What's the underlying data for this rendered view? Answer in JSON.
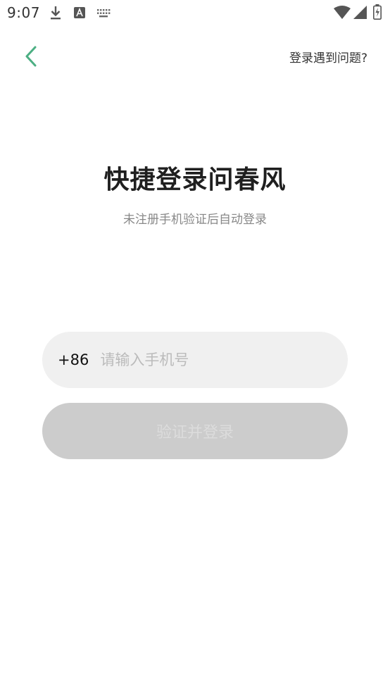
{
  "status_bar": {
    "time": "9:07",
    "icons": [
      "download-icon",
      "text-a-icon",
      "keyboard-icon",
      "wifi-icon",
      "signal-icon",
      "battery-icon"
    ]
  },
  "header": {
    "back_icon": "chevron-left-icon",
    "help_label": "登录遇到问题?"
  },
  "main": {
    "title": "快捷登录问春风",
    "subtitle": "未注册手机验证后自动登录",
    "phone": {
      "country_code": "+86",
      "value": "",
      "placeholder": "请输入手机号"
    },
    "submit_label": "验证并登录"
  },
  "colors": {
    "accent": "#4caf83",
    "field_bg": "#f0f0f0",
    "button_disabled_bg": "#cccccc",
    "button_disabled_text": "#dcdcdc"
  }
}
